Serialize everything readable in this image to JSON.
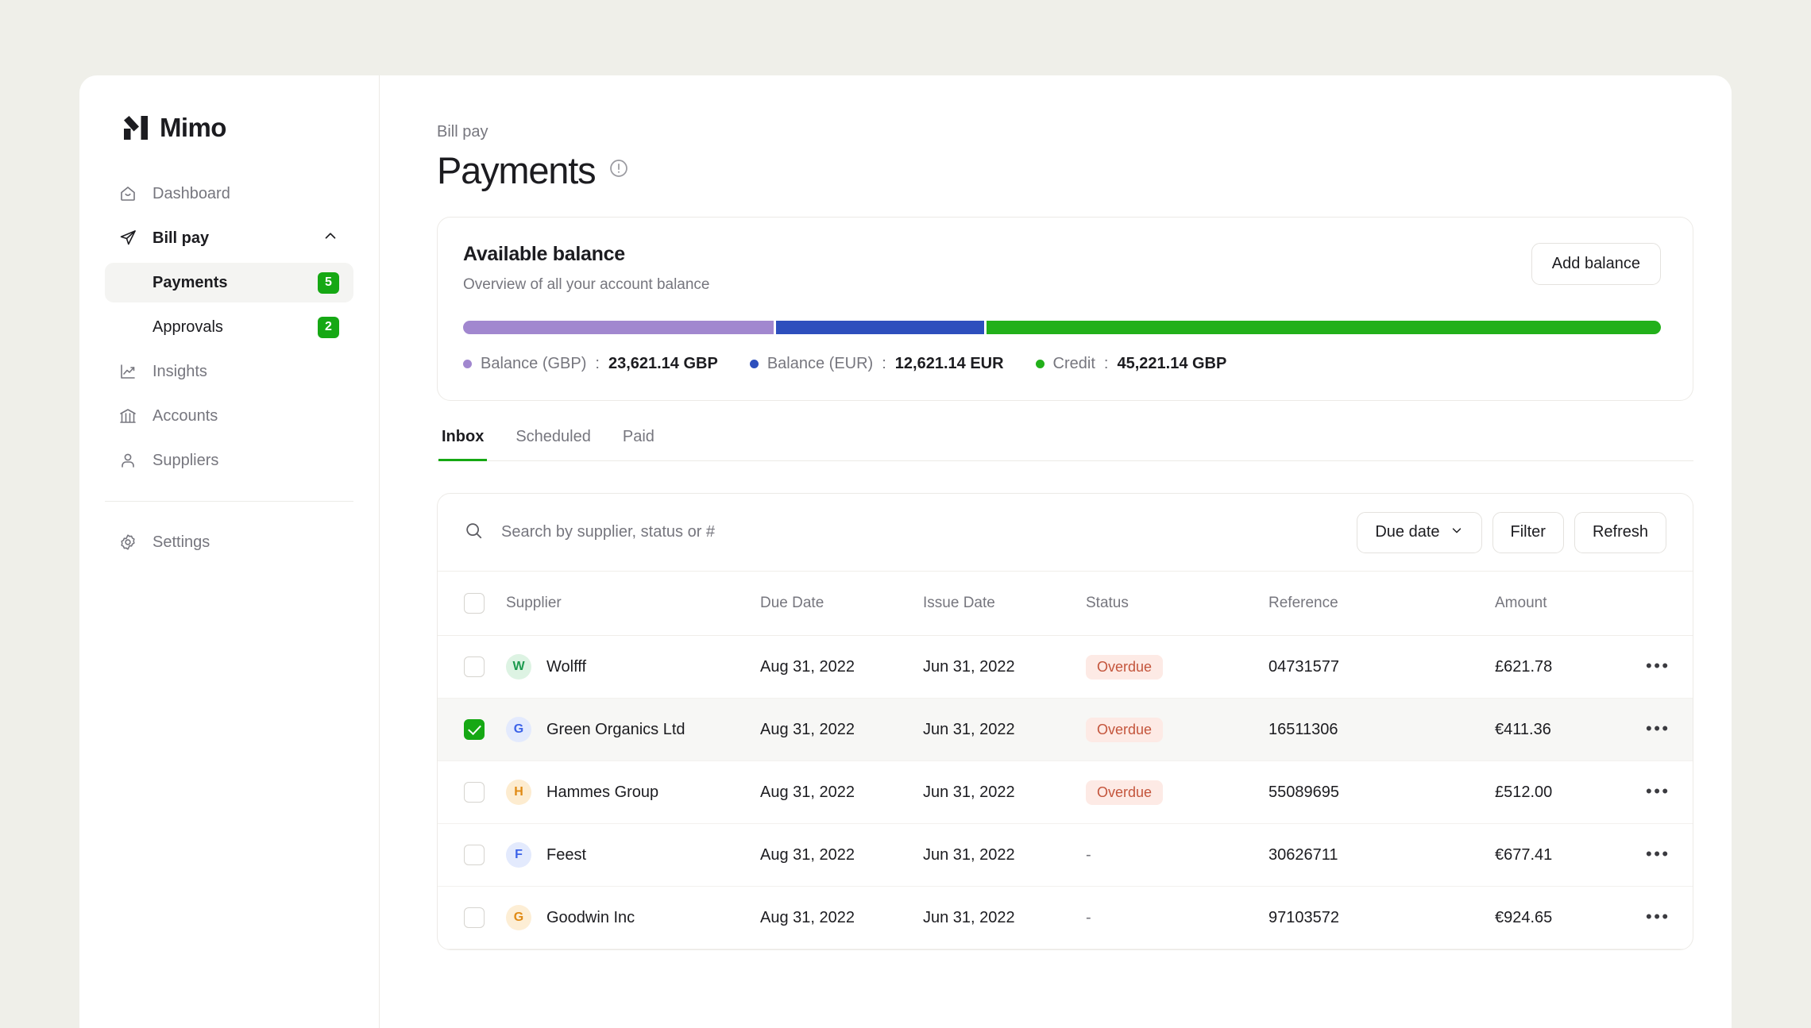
{
  "brand": {
    "name": "Mimo",
    "logo_icon": "mimo-logo-mark"
  },
  "sidebar": {
    "items": [
      {
        "label": "Dashboard",
        "icon": "home-icon"
      },
      {
        "label": "Bill pay",
        "icon": "send-icon",
        "chevron": "chevron-up-icon"
      },
      {
        "label": "Insights",
        "icon": "trending-up-icon"
      },
      {
        "label": "Accounts",
        "icon": "bank-icon"
      },
      {
        "label": "Suppliers",
        "icon": "user-icon"
      }
    ],
    "sub_items": [
      {
        "label": "Payments",
        "badge": "5"
      },
      {
        "label": "Approvals",
        "badge": "2"
      }
    ],
    "settings": {
      "label": "Settings",
      "icon": "gear-icon"
    }
  },
  "header": {
    "breadcrumb": "Bill pay",
    "title": "Payments",
    "info_icon": "info-circle-icon"
  },
  "balance": {
    "title": "Available balance",
    "subtitle": "Overview of all your account balance",
    "add_button": "Add balance",
    "segments": [
      {
        "label": "Balance (GBP)",
        "value": "23,621.14 GBP",
        "color": "#a187cf",
        "percent": 26
      },
      {
        "label": "Balance (EUR)",
        "value": "12,621.14 EUR",
        "color": "#2d4fbd",
        "percent": 17.5
      },
      {
        "label": "Credit",
        "value": "45,221.14 GBP",
        "color": "#22b01a",
        "percent": 56.5
      }
    ]
  },
  "tabs": [
    {
      "label": "Inbox",
      "active": true
    },
    {
      "label": "Scheduled",
      "active": false
    },
    {
      "label": "Paid",
      "active": false
    }
  ],
  "toolbar": {
    "search_placeholder": "Search by supplier, status or #",
    "search_value": "",
    "search_icon": "search-icon",
    "sort_label": "Due date",
    "sort_icon": "chevron-down-icon",
    "filter_label": "Filter",
    "refresh_label": "Refresh"
  },
  "table": {
    "columns": [
      "Supplier",
      "Due Date",
      "Issue Date",
      "Status",
      "Reference",
      "Amount"
    ],
    "rows": [
      {
        "selected": false,
        "initial": "W",
        "supplier": "Wolfff",
        "avatar_bg": "#ddf3e3",
        "avatar_fg": "#1d9a4f",
        "due_date": "Aug 31, 2022",
        "issue_date": "Jun 31, 2022",
        "status": "Overdue",
        "reference": "04731577",
        "amount": "£621.78",
        "more_icon": "more-horizontal-icon"
      },
      {
        "selected": true,
        "initial": "G",
        "supplier": "Green Organics Ltd",
        "avatar_bg": "#e3eafd",
        "avatar_fg": "#3c63e8",
        "due_date": "Aug 31, 2022",
        "issue_date": "Jun 31, 2022",
        "status": "Overdue",
        "reference": "16511306",
        "amount": "€411.36",
        "more_icon": "more-horizontal-icon"
      },
      {
        "selected": false,
        "initial": "H",
        "supplier": "Hammes Group",
        "avatar_bg": "#fdecd0",
        "avatar_fg": "#e08a14",
        "due_date": "Aug 31, 2022",
        "issue_date": "Jun 31, 2022",
        "status": "Overdue",
        "reference": "55089695",
        "amount": "£512.00",
        "more_icon": "more-horizontal-icon"
      },
      {
        "selected": false,
        "initial": "F",
        "supplier": "Feest",
        "avatar_bg": "#e3eafd",
        "avatar_fg": "#3c63e8",
        "due_date": "Aug 31, 2022",
        "issue_date": "Jun 31, 2022",
        "status": "-",
        "reference": "30626711",
        "amount": "€677.41",
        "more_icon": "more-horizontal-icon"
      },
      {
        "selected": false,
        "initial": "G",
        "supplier": "Goodwin Inc",
        "avatar_bg": "#fdeed5",
        "avatar_fg": "#e08a14",
        "due_date": "Aug 31, 2022",
        "issue_date": "Jun 31, 2022",
        "status": "-",
        "reference": "97103572",
        "amount": "€924.65",
        "more_icon": "more-horizontal-icon"
      }
    ]
  },
  "colors": {
    "page_bg": "#efefe9",
    "accent_green": "#16a814",
    "overdue_bg": "#fdeae5",
    "overdue_fg": "#c4553c"
  }
}
